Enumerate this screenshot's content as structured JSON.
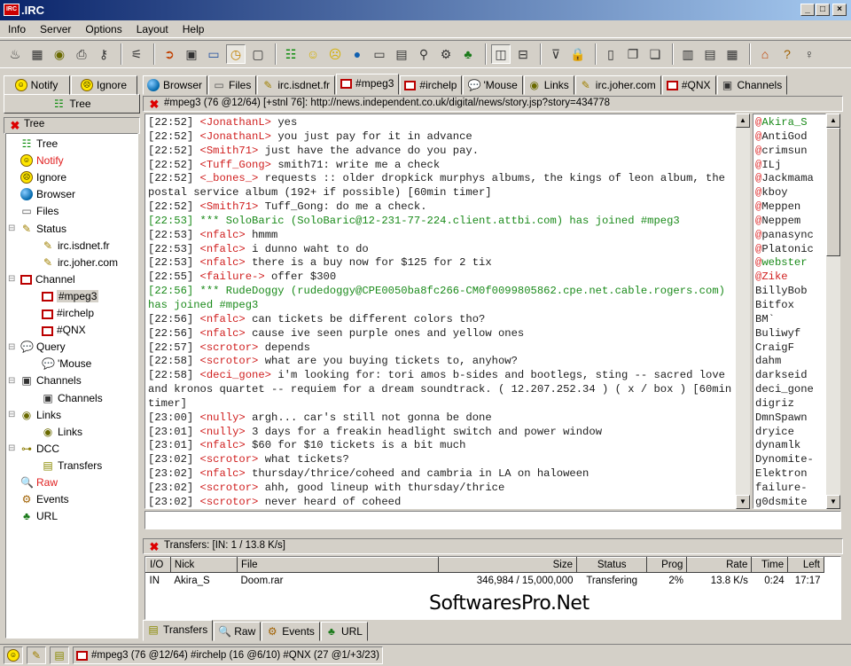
{
  "window": {
    "title": ".IRC",
    "logo_text": "IRC",
    "controls": [
      "_",
      "□",
      "×"
    ]
  },
  "menu": [
    "Info",
    "Server",
    "Options",
    "Layout",
    "Help"
  ],
  "toolbar": {
    "groups": [
      [
        "lightbulb-icon",
        "id-card-icon",
        "eye-icon",
        "printer-icon",
        "key-icon"
      ],
      [
        "plug-icon"
      ],
      [
        "exit-icon",
        "portrait-icon",
        "cassette-icon",
        "clock-icon",
        "bag-icon"
      ],
      [
        "tree-icon",
        "smiley-icon",
        "sad-smiley-icon",
        "globe-icon",
        "drive-icon",
        "dcc-icon",
        "magnifier-icon",
        "gear-icon",
        "url-icon"
      ],
      [
        "tile-vertical-icon",
        "tile-horizontal-icon"
      ],
      [
        "funnel-icon",
        "lock-icon"
      ],
      [
        "window1-icon",
        "window2-icon",
        "window3-icon"
      ],
      [
        "layout1-icon",
        "layout2-icon",
        "layout3-icon"
      ],
      [
        "home-icon",
        "help-icon",
        "bulb-icon"
      ]
    ],
    "pressed": [
      "clock-icon",
      "tile-vertical-icon"
    ]
  },
  "left_tabs": [
    {
      "label": "Notify",
      "icon": "smiley"
    },
    {
      "label": "Ignore",
      "icon": "sad"
    }
  ],
  "left_header": "Tree",
  "tree_header": "Tree",
  "tree": [
    {
      "label": "Tree",
      "icon": "tree",
      "level": 0
    },
    {
      "label": "Notify",
      "icon": "smiley",
      "level": 0,
      "color": "#e02020"
    },
    {
      "label": "Ignore",
      "icon": "sad",
      "level": 0
    },
    {
      "label": "Browser",
      "icon": "globe",
      "level": 0
    },
    {
      "label": "Files",
      "icon": "drive",
      "level": 0
    },
    {
      "label": "Status",
      "icon": "status",
      "level": 0,
      "expanded": true
    },
    {
      "label": "irc.isdnet.fr",
      "icon": "status",
      "level": 1
    },
    {
      "label": "irc.joher.com",
      "icon": "status",
      "level": 1
    },
    {
      "label": "Channel",
      "icon": "tv",
      "level": 0,
      "expanded": true
    },
    {
      "label": "#mpeg3",
      "icon": "tv",
      "level": 1,
      "selected": true
    },
    {
      "label": "#irchelp",
      "icon": "tv",
      "level": 1
    },
    {
      "label": "#QNX",
      "icon": "tv",
      "level": 1
    },
    {
      "label": "Query",
      "icon": "query",
      "level": 0,
      "expanded": true
    },
    {
      "label": "'Mouse",
      "icon": "query",
      "level": 1
    },
    {
      "label": "Channels",
      "icon": "channels",
      "level": 0,
      "expanded": true
    },
    {
      "label": "Channels",
      "icon": "channels",
      "level": 1
    },
    {
      "label": "Links",
      "icon": "eye",
      "level": 0,
      "expanded": true
    },
    {
      "label": "Links",
      "icon": "eye",
      "level": 1
    },
    {
      "label": "DCC",
      "icon": "dcc",
      "level": 0,
      "expanded": true
    },
    {
      "label": "Transfers",
      "icon": "transfers",
      "level": 1
    },
    {
      "label": "Raw",
      "icon": "raw",
      "level": 0,
      "color": "#e02020"
    },
    {
      "label": "Events",
      "icon": "gear",
      "level": 0
    },
    {
      "label": "URL",
      "icon": "url",
      "level": 0
    }
  ],
  "main_tabs": [
    {
      "label": "Browser",
      "icon": "globe"
    },
    {
      "label": "Files",
      "icon": "drive"
    },
    {
      "label": "irc.isdnet.fr",
      "icon": "status"
    },
    {
      "label": "#mpeg3",
      "icon": "tv",
      "active": true
    },
    {
      "label": "#irchelp",
      "icon": "tv"
    },
    {
      "label": "'Mouse",
      "icon": "query"
    },
    {
      "label": "Links",
      "icon": "eye"
    },
    {
      "label": "irc.joher.com",
      "icon": "status"
    },
    {
      "label": "#QNX",
      "icon": "tv"
    },
    {
      "label": "Channels",
      "icon": "channels"
    }
  ],
  "topic": "#mpeg3 (76 @12/64) [+stnl 76]: http://news.independent.co.uk/digital/news/story.jsp?story=434778",
  "chat": [
    {
      "time": "[22:52]",
      "nick": "<JonathanL>",
      "text": "yes"
    },
    {
      "time": "[22:52]",
      "nick": "<JonathanL>",
      "text": "you just pay for it in advance"
    },
    {
      "time": "[22:52]",
      "nick": "<Smith71>",
      "text": "just have the advance do you pay."
    },
    {
      "time": "[22:52]",
      "nick": "<Tuff_Gong>",
      "text": "smith71: write me a check"
    },
    {
      "time": "[22:52]",
      "nick": "<_bones_>",
      "text": "requests :: older dropkick murphys albums, the kings of leon album, the postal service album (192+ if possible) [60min timer]"
    },
    {
      "time": "[22:52]",
      "nick": "<Smith71>",
      "text": "Tuff_Gong:  do me a check."
    },
    {
      "time": "[22:53]",
      "type": "join",
      "text": "*** SoloBaric (SoloBaric@12-231-77-224.client.attbi.com) has joined #mpeg3"
    },
    {
      "time": "[22:53]",
      "nick": "<nfalc>",
      "text": "hmmm"
    },
    {
      "time": "[22:53]",
      "nick": "<nfalc>",
      "text": "i dunno waht to do"
    },
    {
      "time": "[22:53]",
      "nick": "<nfalc>",
      "text": "there is a buy now for $125 for 2 tix"
    },
    {
      "time": "[22:55]",
      "nick": "<failure->",
      "text": "offer $300"
    },
    {
      "time": "[22:56]",
      "type": "join",
      "text": "*** RudeDoggy (rudedoggy@CPE0050ba8fc266-CM0f0099805862.cpe.net.cable.rogers.com) has joined #mpeg3"
    },
    {
      "time": "[22:56]",
      "nick": "<nfalc>",
      "text": "can tickets be different colors tho?"
    },
    {
      "time": "[22:56]",
      "nick": "<nfalc>",
      "text": "cause ive seen purple ones and yellow ones"
    },
    {
      "time": "[22:57]",
      "nick": "<scrotor>",
      "text": "depends"
    },
    {
      "time": "[22:58]",
      "nick": "<scrotor>",
      "text": "what are you buying tickets to, anyhow?"
    },
    {
      "time": "[22:58]",
      "nick": "<deci_gone>",
      "text": "i'm looking for: tori amos b-sides and bootlegs, sting -- sacred love and kronos quartet -- requiem for a dream soundtrack. ( 12.207.252.34 ) ( x / box ) [60min timer]"
    },
    {
      "time": "[23:00]",
      "nick": "<nully>",
      "text": "argh... car's still not gonna be done"
    },
    {
      "time": "[23:01]",
      "nick": "<nully>",
      "text": "3 days for a freakin headlight switch and power window"
    },
    {
      "time": "[23:01]",
      "nick": "<nfalc>",
      "text": "$60 for $10 tickets is a bit much"
    },
    {
      "time": "[23:02]",
      "nick": "<scrotor>",
      "text": "what tickets?"
    },
    {
      "time": "[23:02]",
      "nick": "<nfalc>",
      "text": "thursday/thrice/coheed and cambria in LA on haloween"
    },
    {
      "time": "[23:02]",
      "nick": "<scrotor>",
      "text": "ahh, good lineup with thursday/thrice"
    },
    {
      "time": "[23:02]",
      "nick": "<scrotor>",
      "text": "never heard of coheed"
    }
  ],
  "input_value": "",
  "nicks": [
    {
      "name": "Akira_S",
      "op": true,
      "color": "green"
    },
    {
      "name": "AntiGod",
      "op": true
    },
    {
      "name": "crimsun",
      "op": true
    },
    {
      "name": "ILj",
      "op": true
    },
    {
      "name": "Jackmama",
      "op": true
    },
    {
      "name": "kboy",
      "op": true
    },
    {
      "name": "Meppen",
      "op": true
    },
    {
      "name": "Neppem",
      "op": true
    },
    {
      "name": "panasync",
      "op": true
    },
    {
      "name": "Platonic",
      "op": true
    },
    {
      "name": "webster",
      "op": true,
      "color": "green"
    },
    {
      "name": "Zike",
      "op": true,
      "color": "red"
    },
    {
      "name": "BillyBob"
    },
    {
      "name": "Bitfox"
    },
    {
      "name": "BM`"
    },
    {
      "name": "Buliwyf"
    },
    {
      "name": "CraigF"
    },
    {
      "name": "dahm"
    },
    {
      "name": "darkseid"
    },
    {
      "name": "deci_gone"
    },
    {
      "name": "digriz"
    },
    {
      "name": "DmnSpawn"
    },
    {
      "name": "dryice"
    },
    {
      "name": "dynamlk"
    },
    {
      "name": "Dynomite-"
    },
    {
      "name": "Elektron"
    },
    {
      "name": "failure-"
    },
    {
      "name": "g0dsmite"
    }
  ],
  "transfers": {
    "header": "Transfers: [IN: 1 / 13.8 K/s]",
    "columns": [
      "I/O",
      "Nick",
      "File",
      "Size",
      "Status",
      "Prog",
      "Rate",
      "Time",
      "Left"
    ],
    "rows": [
      [
        "IN",
        "Akira_S",
        "Doom.rar",
        "346,984 / 15,000,000",
        "Transfering",
        "2%",
        "13.8 K/s",
        "0:24",
        "17:17"
      ]
    ]
  },
  "bottom_tabs": [
    {
      "label": "Transfers",
      "icon": "transfers",
      "active": true
    },
    {
      "label": "Raw",
      "icon": "raw"
    },
    {
      "label": "Events",
      "icon": "gear"
    },
    {
      "label": "URL",
      "icon": "url"
    }
  ],
  "statusbar": {
    "icons": [
      "smiley",
      "status",
      "transfers"
    ],
    "channels": "#mpeg3 (76 @12/64)  #irchelp (16 @6/10)  #QNX (27 @1/+3/23)"
  },
  "watermark": "SoftwaresPro.Net"
}
